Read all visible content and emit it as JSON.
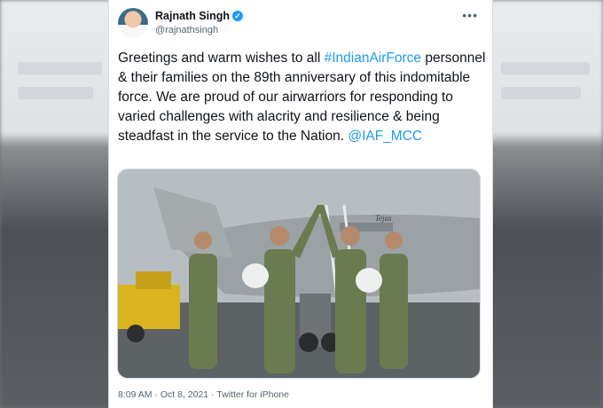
{
  "tweet": {
    "author_name": "Rajnath Singh",
    "handle": "@rajnathsingh",
    "text_lead": "Greetings and warm wishes to all ",
    "hashtag": "#IndianAirForce",
    "text_body": " personnel & their families on the 89th anniversary of this indomitable force. We are proud of our airwarriors for responding to varied challenges with alacrity and resilience & being steadfast in the service to the Nation. ",
    "mention": "@IAF_MCC",
    "timestamp": "8:09 AM · Oct 8, 2021 · Twitter for iPhone",
    "verified_glyph": "✓",
    "more_glyph": "•••"
  },
  "media": {
    "aircraft_label": "Tejas"
  },
  "icons": {
    "verified": "verified-badge-icon",
    "more": "more-options-icon"
  },
  "colors": {
    "accent": "#1d9bf0",
    "text": "#0f1419",
    "secondary": "#536471"
  }
}
